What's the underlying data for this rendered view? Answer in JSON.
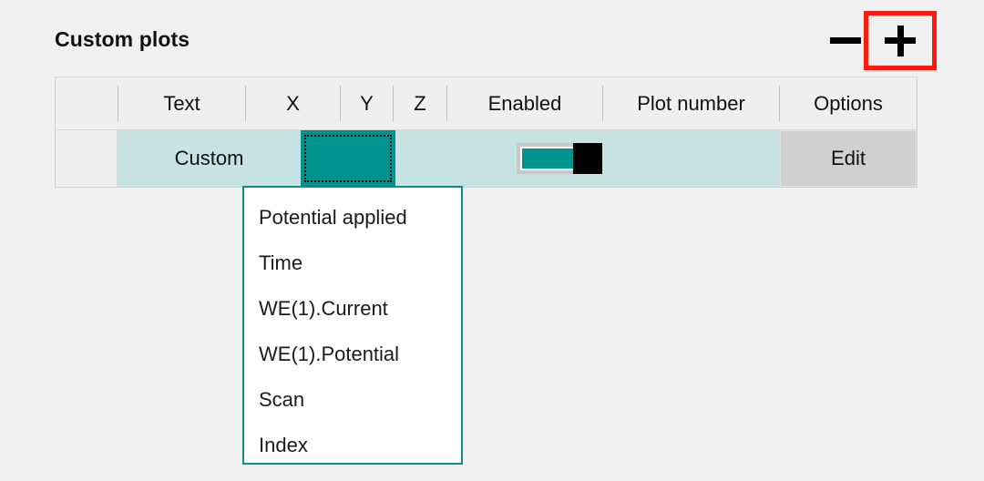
{
  "page": {
    "title": "Custom plots",
    "background_color": "#F0F0F0"
  },
  "colors": {
    "accent_teal": "#009490",
    "row_selected": "#C6E3E1",
    "header_bg": "#EFEFEF",
    "highlight_red": "#FF1A10",
    "dropdown_border": "#0E8C88",
    "button_gray": "#D0D0D0"
  },
  "row_controls": {
    "remove_label": "−",
    "remove_icon": "minus-icon",
    "add_label": "+",
    "add_icon": "plus-icon",
    "add_highlighted": "true"
  },
  "grid": {
    "columns": [
      {
        "key": "rowheader",
        "label": ""
      },
      {
        "key": "text",
        "label": "Text"
      },
      {
        "key": "x",
        "label": "X"
      },
      {
        "key": "y",
        "label": "Y"
      },
      {
        "key": "z",
        "label": "Z"
      },
      {
        "key": "enabled",
        "label": "Enabled"
      },
      {
        "key": "plotnumber",
        "label": "Plot number"
      },
      {
        "key": "options",
        "label": "Options"
      }
    ],
    "rows": [
      {
        "text": "Custom",
        "x": "",
        "y": "",
        "z": "",
        "enabled": "on",
        "plot_number": "",
        "options_label": "Edit",
        "selected": "true"
      }
    ]
  },
  "x_dropdown": {
    "open": "true",
    "items": [
      "Potential applied",
      "Time",
      "WE(1).Current",
      "WE(1).Potential",
      "Scan",
      "Index"
    ]
  }
}
